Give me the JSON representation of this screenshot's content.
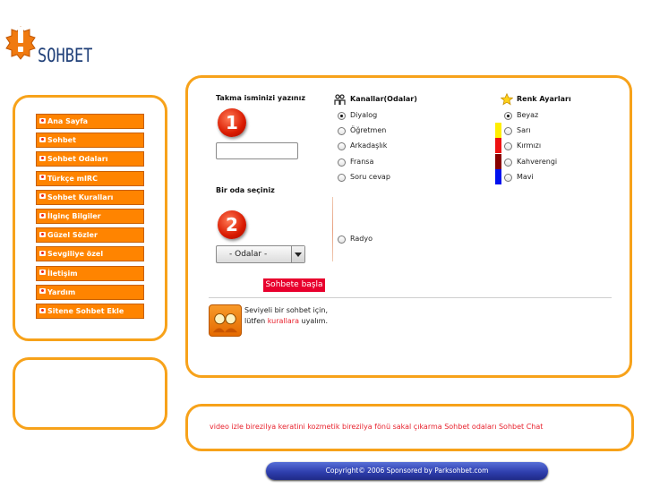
{
  "logo": {
    "text": "SOHBET"
  },
  "nav": {
    "items": [
      {
        "label": "Ana Sayfa"
      },
      {
        "label": "Sohbet"
      },
      {
        "label": "Sohbet Odaları"
      },
      {
        "label": "Türkçe mIRC"
      },
      {
        "label": "Sohbet Kuralları"
      },
      {
        "label": "İlginç Bilgiler"
      },
      {
        "label": "Güzel Sözler"
      },
      {
        "label": "Sevgiliye özel"
      },
      {
        "label": "İletişim"
      },
      {
        "label": "Yardım"
      },
      {
        "label": "Sitene Sohbet Ekle"
      }
    ]
  },
  "form": {
    "nick_label": "Takma isminizi yazınız",
    "step1": "1",
    "nick_value": "",
    "room_label": "Bir oda seçiniz",
    "step2": "2",
    "room_select_value": "- Odalar -",
    "start_button": "Sohbete başla"
  },
  "channels": {
    "title": "Kanallar(Odalar)",
    "icon": "channels-icon",
    "options": [
      {
        "label": "Diyalog",
        "selected": true
      },
      {
        "label": "Öğretmen",
        "selected": false
      },
      {
        "label": "Arkadaşlık",
        "selected": false
      },
      {
        "label": "Fransa",
        "selected": false
      },
      {
        "label": "Soru cevap",
        "selected": false
      },
      {
        "label": "Radyo",
        "selected": false
      }
    ]
  },
  "colors": {
    "title": "Renk Ayarları",
    "icon": "star-icon",
    "options": [
      {
        "label": "Beyaz",
        "selected": true,
        "swatch": ""
      },
      {
        "label": "Sarı",
        "selected": false,
        "swatch": "#ffee00"
      },
      {
        "label": "Kırmızı",
        "selected": false,
        "swatch": "#ee1111"
      },
      {
        "label": "Kahverengi",
        "selected": false,
        "swatch": "#880000"
      },
      {
        "label": "Mavi",
        "selected": false,
        "swatch": "#0011ee"
      }
    ]
  },
  "rules": {
    "line1": "Seviyeli bir sohbet için,",
    "line2_prefix": "lütfen ",
    "link": "kurallara",
    "line2_suffix": " uyalım."
  },
  "footer": {
    "links": "video izle birezilya keratini kozmetik birezilya fönü sakal çıkarma Sohbet odaları Sohbet Chat",
    "copyright": "Copyright© 2006 Sponsored by Parksohbet.com"
  },
  "theme": {
    "accent": "#f7a21a",
    "nav_bg": "#ff8400",
    "button_red": "#e8002d",
    "footer_blue": "#2f3fae"
  }
}
